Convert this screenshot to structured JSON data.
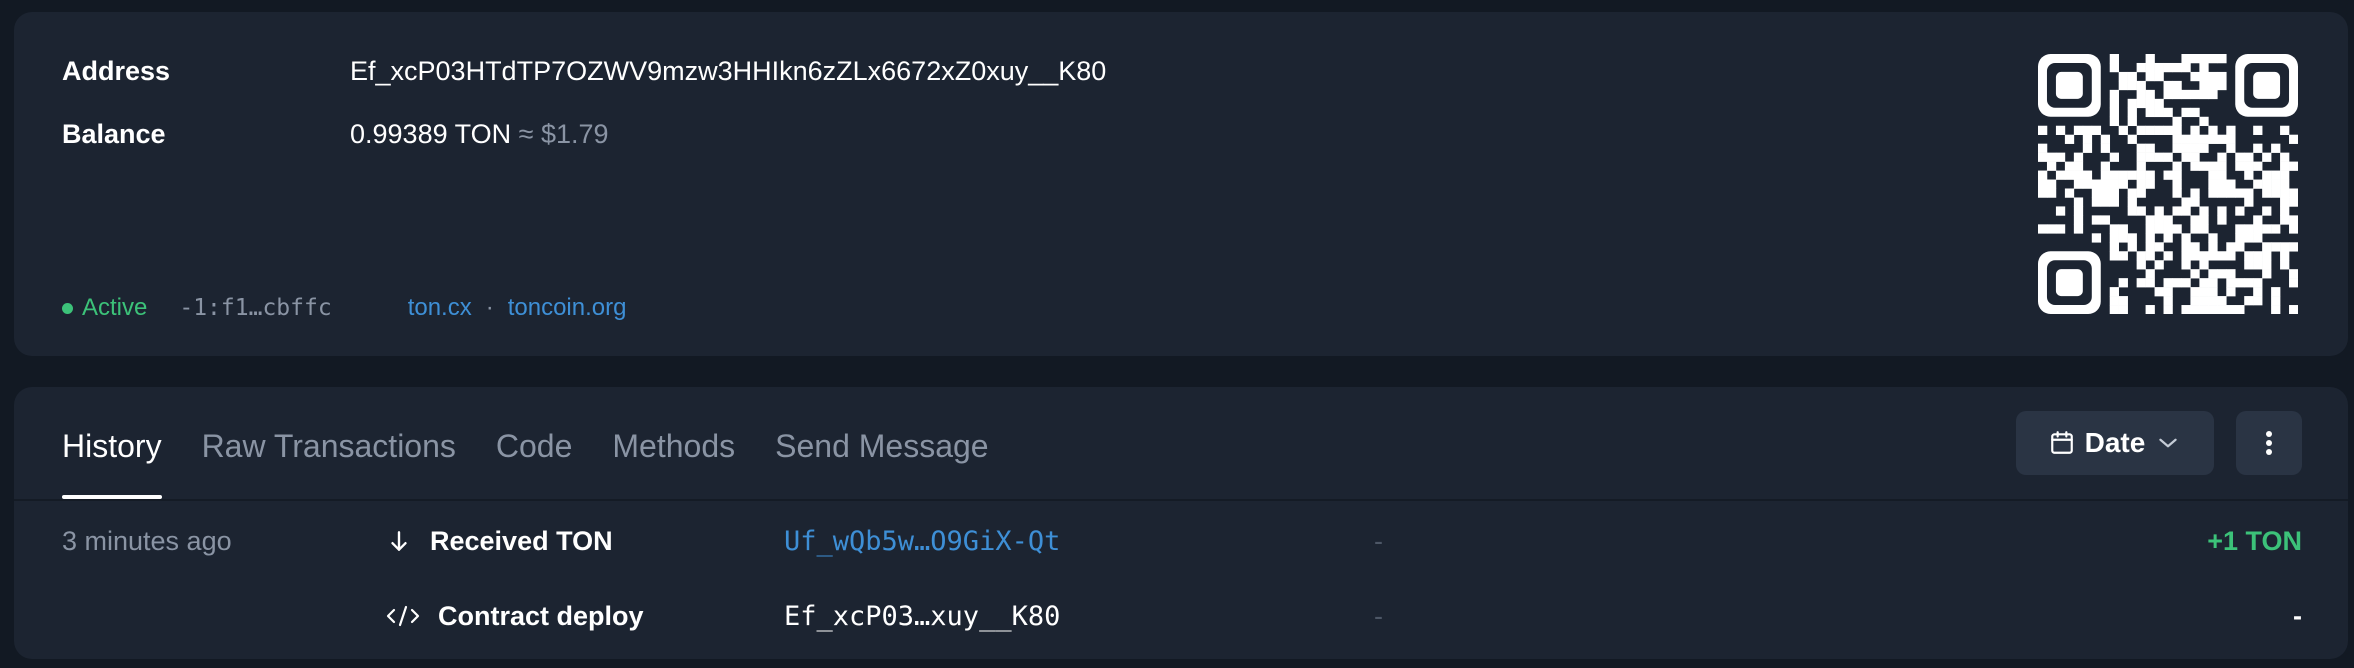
{
  "account": {
    "address_label": "Address",
    "address_value": "Ef_xcP03HTdTP7OZWV9mzw3HHIkn6zZLx6672xZ0xuy__K80",
    "balance_label": "Balance",
    "balance_value": "0.99389 TON",
    "balance_fiat": "≈ $1.79",
    "status": "Active",
    "raw_address": "-1:f1…cbffc",
    "link_1": "ton.cx",
    "link_sep": "·",
    "link_2": "toncoin.org"
  },
  "colors": {
    "active": "#3cc279",
    "link": "#3e8fd6",
    "positive": "#3cc279"
  },
  "tabs": [
    {
      "label": "History",
      "active": true
    },
    {
      "label": "Raw Transactions",
      "active": false
    },
    {
      "label": "Code",
      "active": false
    },
    {
      "label": "Methods",
      "active": false
    },
    {
      "label": "Send Message",
      "active": false
    }
  ],
  "toolbar": {
    "date_label": "Date",
    "date_icon": "calendar-icon",
    "more_icon": "more-vertical-icon"
  },
  "history": [
    {
      "time": "3 minutes ago",
      "icon": "arrow-down-icon",
      "action": "Received TON",
      "address": "Uf_wQb5w…O9GiX-Qt",
      "address_is_link": true,
      "comment": "-",
      "amount": "+1 TON",
      "amount_color": "#3cc279"
    },
    {
      "time": "",
      "icon": "code-icon",
      "action": "Contract deploy",
      "address": "Ef_xcP03…xuy__K80",
      "address_is_link": false,
      "comment": "-",
      "amount": "-",
      "amount_color": "#ffffff"
    }
  ]
}
